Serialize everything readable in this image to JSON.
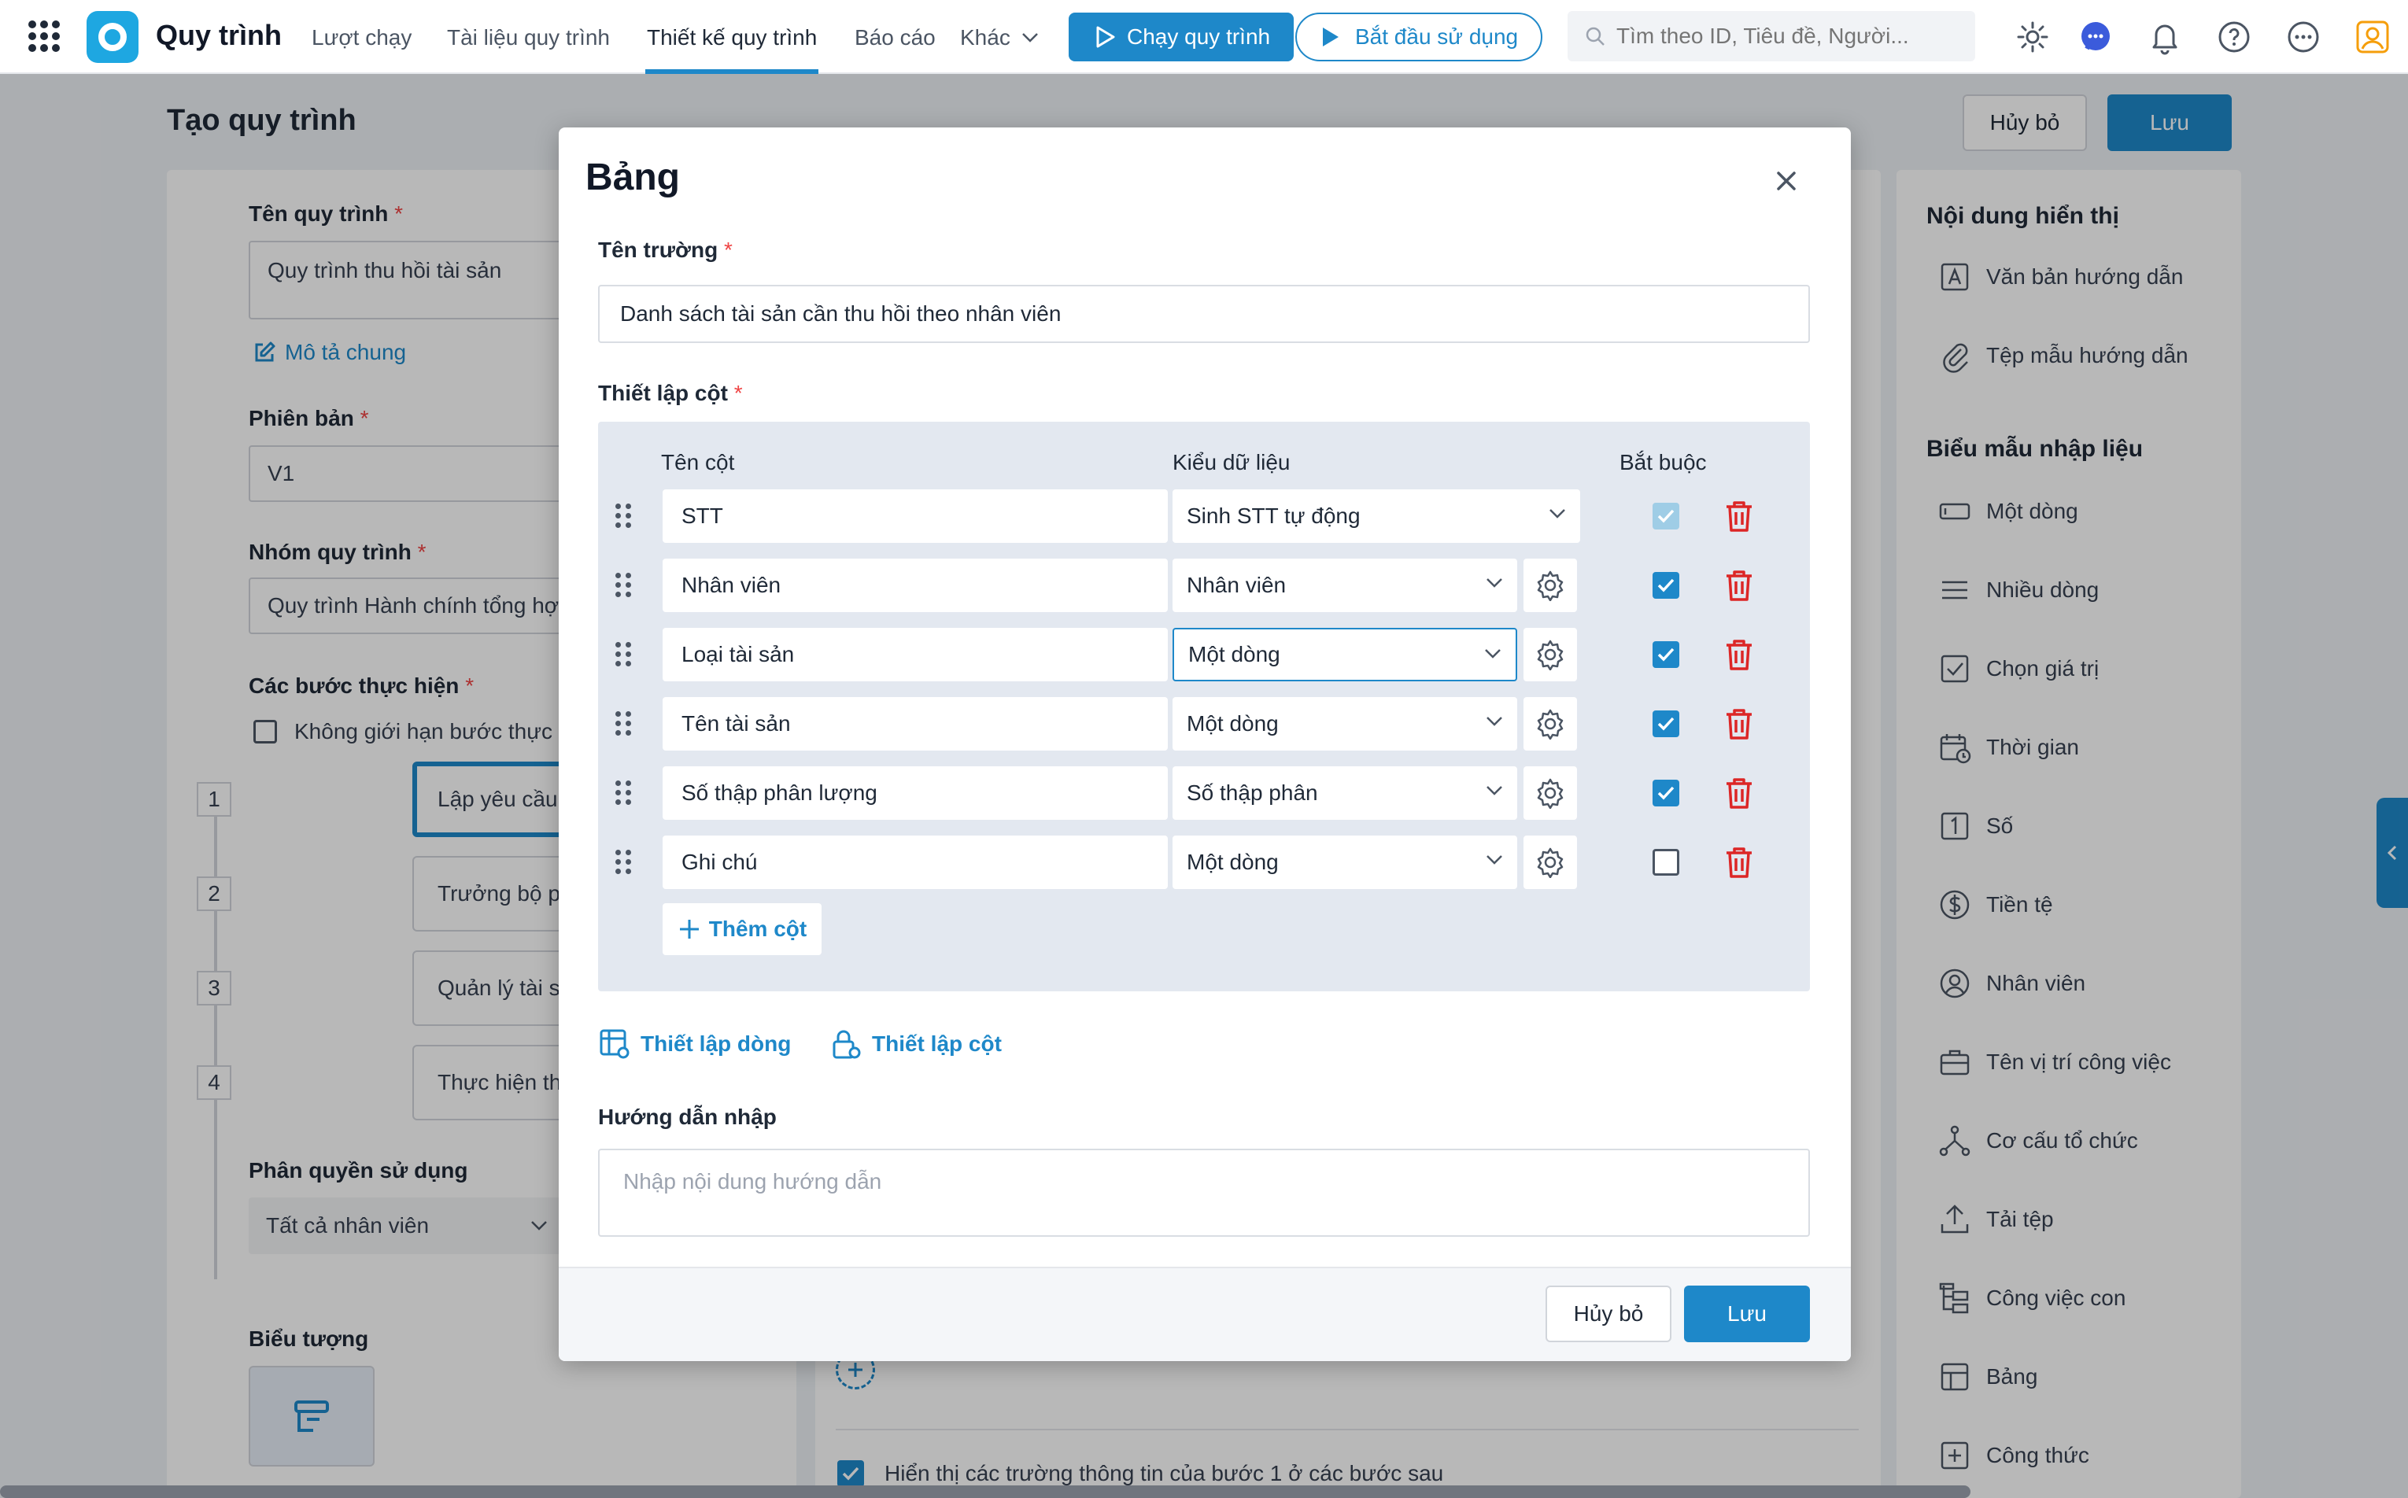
{
  "app": {
    "name": "Quy trình"
  },
  "nav": {
    "items": [
      "Lượt chạy",
      "Tài liệu quy trình",
      "Thiết kế quy trình",
      "Báo cáo",
      "Khác"
    ],
    "run_button": "Chạy quy trình",
    "start_button": "Bắt đầu sử dụng",
    "search_placeholder": "Tìm theo ID, Tiêu đề, Người..."
  },
  "page": {
    "title": "Tạo quy trình",
    "cancel": "Hủy bỏ",
    "save": "Lưu",
    "process_name_label": "Tên quy trình",
    "process_name_value": "Quy trình thu hồi tài sản",
    "description_link": "Mô tả chung",
    "version_label": "Phiên bản",
    "version_value": "V1",
    "group_label": "Nhóm quy trình",
    "group_value": "Quy trình Hành chính tổng hợp",
    "steps_label": "Các bước thực hiện",
    "unlimited_steps": "Không giới hạn bước thực h",
    "steps": [
      {
        "num": "1",
        "name": "Lập yêu cầu thu hồi tài sản"
      },
      {
        "num": "2",
        "name": "Trưởng bộ phận xem xét"
      },
      {
        "num": "3",
        "name": "Quản lý tài sản phê duyệt yêu"
      },
      {
        "num": "4",
        "name": "Thực hiện thu hồi tài sản"
      }
    ],
    "permission_label": "Phân quyền sử dụng",
    "permission_value": "Tất cả nhân viên",
    "icon_label": "Biểu tượng",
    "bottom_checkbox": "Hiển thị các trường thông tin của bước 1 ở các bước sau"
  },
  "right_panel": {
    "display_title": "Nội dung hiển thị",
    "display_items": [
      {
        "label": "Văn bản hướng dẫn",
        "icon": "text-icon"
      },
      {
        "label": "Tệp mẫu hướng dẫn",
        "icon": "paperclip-icon"
      }
    ],
    "form_title": "Biểu mẫu nhập liệu",
    "form_items": [
      {
        "label": "Một dòng",
        "icon": "single-line-icon"
      },
      {
        "label": "Nhiều dòng",
        "icon": "multi-line-icon"
      },
      {
        "label": "Chọn giá trị",
        "icon": "checkbox-icon"
      },
      {
        "label": "Thời gian",
        "icon": "calendar-icon"
      },
      {
        "label": "Số",
        "icon": "number-icon"
      },
      {
        "label": "Tiền tệ",
        "icon": "currency-icon"
      },
      {
        "label": "Nhân viên",
        "icon": "user-icon"
      },
      {
        "label": "Tên vị trí công việc",
        "icon": "briefcase-icon"
      },
      {
        "label": "Cơ cấu tổ chức",
        "icon": "org-icon"
      },
      {
        "label": "Tải tệp",
        "icon": "upload-icon"
      },
      {
        "label": "Công việc con",
        "icon": "subtask-icon"
      },
      {
        "label": "Bảng",
        "icon": "table-icon"
      },
      {
        "label": "Công thức",
        "icon": "formula-icon"
      }
    ]
  },
  "modal": {
    "title": "Bảng",
    "field_name_label": "Tên trường",
    "field_name_value": "Danh sách tài sản cần thu hồi theo nhân viên",
    "column_setup_label": "Thiết lập cột",
    "headers": {
      "name": "Tên cột",
      "type": "Kiểu dữ liệu",
      "required": "Bắt buộc"
    },
    "columns": [
      {
        "name": "STT",
        "type": "Sinh STT tự động",
        "required": true,
        "locked": true
      },
      {
        "name": "Nhân viên",
        "type": "Nhân viên",
        "required": true,
        "locked": false
      },
      {
        "name": "Loại tài sản",
        "type": "Một dòng",
        "required": true,
        "locked": false
      },
      {
        "name": "Tên tài sản",
        "type": "Một dòng",
        "required": true,
        "locked": false
      },
      {
        "name": "Số thập phân lượng",
        "type": "Số thập phân",
        "required": true,
        "locked": false
      },
      {
        "name": "Ghi chú",
        "type": "Một dòng",
        "required": false,
        "locked": false
      }
    ],
    "add_column": "Thêm cột",
    "row_settings": "Thiết lập dòng",
    "column_settings": "Thiết lập cột",
    "guide_label": "Hướng dẫn nhập",
    "guide_placeholder": "Nhập nội dung hướng dẫn",
    "cancel": "Hủy bỏ",
    "save": "Lưu"
  },
  "colors": {
    "primary": "#1e88c9",
    "danger": "#dc2626",
    "required_star": "#ef4444"
  }
}
